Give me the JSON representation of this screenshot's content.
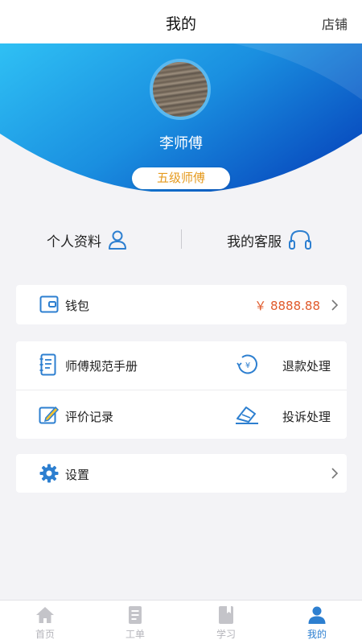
{
  "header": {
    "title": "我的",
    "shop_link": "店铺"
  },
  "profile": {
    "name": "李师傅",
    "level": "五级师傅"
  },
  "quick_links": {
    "profile": "个人资料",
    "service": "我的客服"
  },
  "wallet": {
    "label": "钱包",
    "amount": "￥ 8888.88"
  },
  "service_items": [
    {
      "label": "师傅规范手册",
      "icon": "manual-icon"
    },
    {
      "label": "退款处理",
      "icon": "refund-icon"
    },
    {
      "label": "评价记录",
      "icon": "review-icon"
    },
    {
      "label": "投诉处理",
      "icon": "complaint-icon"
    }
  ],
  "settings": {
    "label": "设置"
  },
  "tabs": [
    {
      "label": "首页",
      "icon": "home-icon"
    },
    {
      "label": "工单",
      "icon": "workorder-icon"
    },
    {
      "label": "学习",
      "icon": "study-icon"
    },
    {
      "label": "我的",
      "icon": "person-icon",
      "active": true
    }
  ],
  "colors": {
    "hero_start": "#2fc0f4",
    "hero_end": "#0a52c2",
    "accent_blue": "#2d7fd0",
    "level_text": "#e59a1e",
    "amount_text": "#e05a2b"
  }
}
